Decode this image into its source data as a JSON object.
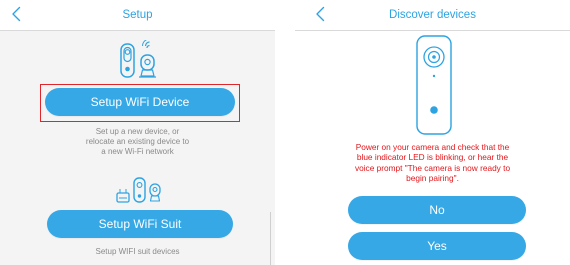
{
  "setup_screen": {
    "title": "Setup",
    "setup_wifi_device": {
      "label": "Setup WiFi Device",
      "description": "Set up a new device, or\nrelocate an existing device to\na new Wi-Fi network"
    },
    "setup_wifi_suit": {
      "label": "Setup WiFi Suit",
      "description": "Setup WIFI suit devices"
    },
    "icons": [
      "back-icon",
      "wifi-camera-icon",
      "camera-suit-icon"
    ]
  },
  "discover_screen": {
    "title": "Discover devices",
    "instruction": "Power on your camera and check that the\nblue indicator LED is blinking, or hear the\nvoice prompt \"The camera is now ready to\nbegin pairing\".",
    "no_label": "No",
    "yes_label": "Yes",
    "icons": [
      "back-icon",
      "doorbell-camera-icon"
    ]
  },
  "colors": {
    "accent": "#36a8e6",
    "title_blue": "#2ea3e2",
    "highlight_red": "#e0262b",
    "warning_red": "#e3161b",
    "muted_text": "#8a8a8a",
    "left_background": "#f4f4f4"
  }
}
